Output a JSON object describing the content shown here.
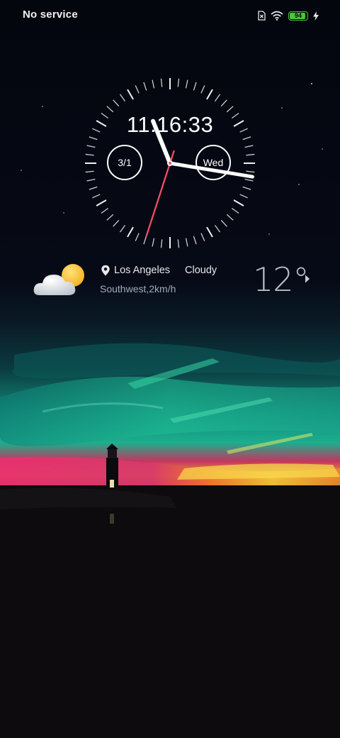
{
  "status_bar": {
    "carrier": "No service",
    "battery_level": "94",
    "battery_fraction": 0.94,
    "battery_color": "#49c63a",
    "icons": [
      "sim-missing-icon",
      "wifi-icon",
      "battery-icon",
      "charging-bolt-icon"
    ]
  },
  "clock": {
    "digital_time": "11:16:33",
    "date": "3/1",
    "day": "Wed",
    "hour": 11,
    "minute": 16,
    "second": 33,
    "second_hand_color": "#ff4d6a"
  },
  "weather": {
    "icon": "partly-cloudy-icon",
    "location": "Los Angeles",
    "condition": "Cloudy",
    "wind": "Southwest,2km/h",
    "temperature": "12°"
  }
}
